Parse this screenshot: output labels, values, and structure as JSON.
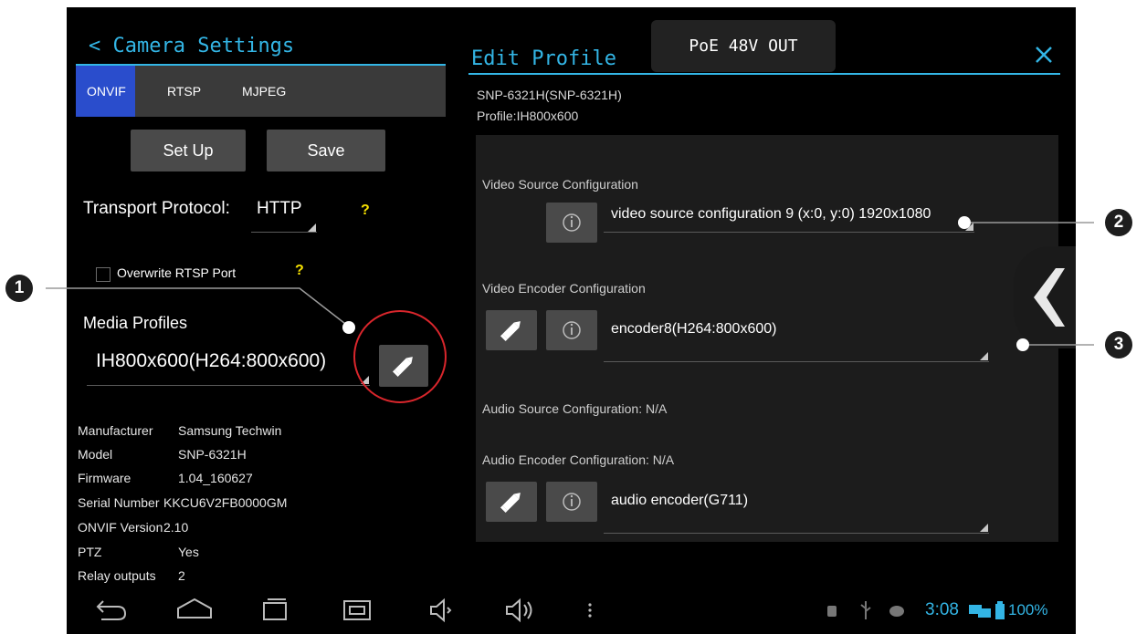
{
  "left_panel": {
    "title": "Camera Settings",
    "back_glyph": "<",
    "tabs": [
      {
        "label": "ONVIF",
        "active": true
      },
      {
        "label": "RTSP",
        "active": false
      },
      {
        "label": "MJPEG",
        "active": false
      }
    ],
    "buttons": {
      "setup": "Set Up",
      "save": "Save"
    },
    "transport": {
      "label": "Transport Protocol:",
      "value": "HTTP",
      "help": "?"
    },
    "overwrite": {
      "label": "Overwrite RTSP Port",
      "checked": false,
      "help": "?"
    },
    "media_profiles": {
      "label": "Media Profiles",
      "value": "IH800x600(H264:800x600)"
    },
    "info": [
      {
        "key": "Manufacturer",
        "value": "Samsung Techwin"
      },
      {
        "key": "Model",
        "value": "SNP-6321H"
      },
      {
        "key": "Firmware",
        "value": "1.04_160627"
      },
      {
        "key": "Serial Number",
        "value": "KKCU6V2FB0000GM"
      },
      {
        "key": "ONVIF Version",
        "value": "2.10"
      },
      {
        "key": "PTZ",
        "value": "Yes"
      },
      {
        "key": "Relay outputs",
        "value": "2"
      }
    ]
  },
  "right_panel": {
    "title": "Edit Profile",
    "device": "SNP-6321H(SNP-6321H)",
    "profile": "Profile:IH800x600",
    "video_source": {
      "heading": "Video Source Configuration",
      "value": "video source configuration 9 (x:0, y:0) 1920x1080"
    },
    "video_encoder": {
      "heading": "Video Encoder Configuration",
      "value": "encoder8(H264:800x600)"
    },
    "audio_source": {
      "heading": "Audio Source Configuration: N/A"
    },
    "audio_encoder": {
      "heading": "Audio Encoder Configuration: N/A",
      "value": "audio encoder(G711)"
    }
  },
  "toast": "PoE 48V OUT",
  "status_bar": {
    "time": "3:08",
    "battery": "100%"
  },
  "callouts": [
    "1",
    "2",
    "3"
  ],
  "colors": {
    "accent": "#33b5e5",
    "active_tab": "#2a4dcc",
    "highlight_circle": "#d9262c",
    "help": "#f5e000"
  }
}
